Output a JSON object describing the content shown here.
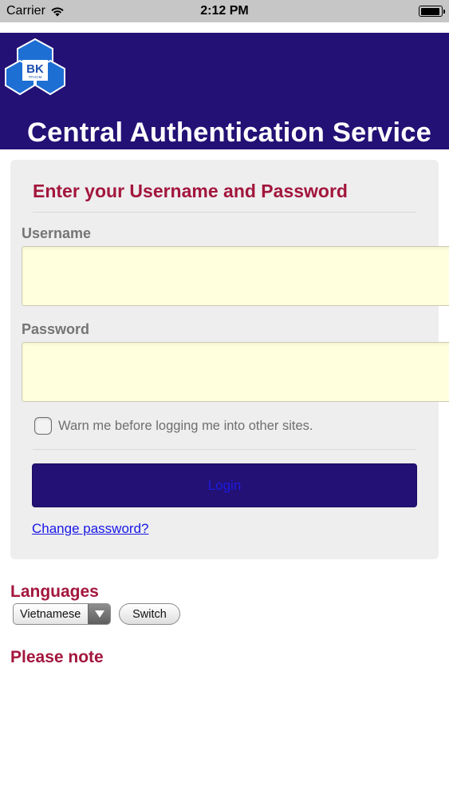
{
  "status_bar": {
    "carrier": "Carrier",
    "time": "2:12 PM",
    "battery_level": 0.95,
    "icons": [
      "wifi-icon",
      "battery-icon"
    ]
  },
  "header": {
    "logo_text": "BK",
    "logo_subtext": "TP.HCM",
    "title": "Central Authentication Service",
    "background_color": "#231175"
  },
  "login": {
    "heading": "Enter your Username and Password",
    "username_label": "Username",
    "username_value": "",
    "password_label": "Password",
    "password_value": "",
    "warn_label": "Warn me before logging me into other sites.",
    "warn_checked": false,
    "login_button": "Login",
    "change_password": "Change password?"
  },
  "languages": {
    "heading": "Languages",
    "selected": "Vietnamese",
    "switch_button": "Switch"
  },
  "note": {
    "heading": "Please note"
  },
  "colors": {
    "accent": "#a3163c",
    "brand": "#231175",
    "input_bg": "#ffffdd",
    "link": "#1717e6"
  }
}
